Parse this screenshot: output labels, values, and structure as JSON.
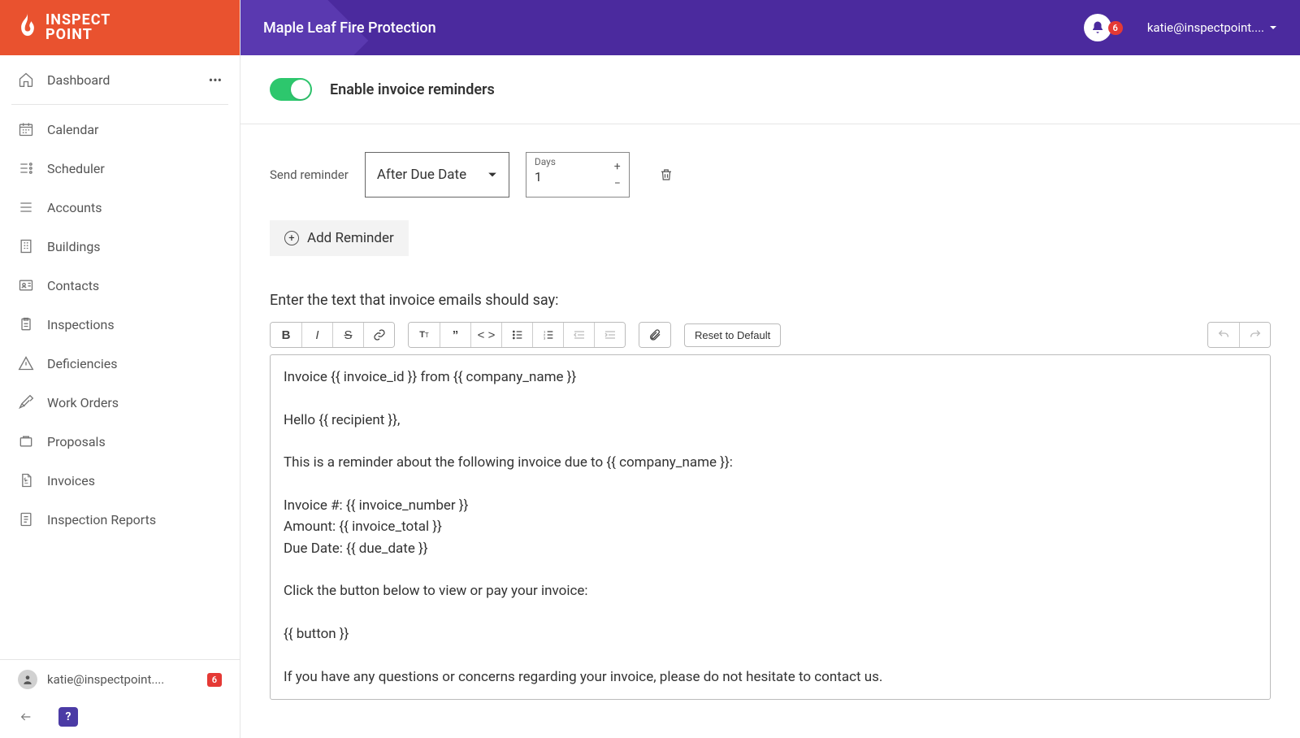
{
  "brand": {
    "line1": "INSPECT",
    "line2": "POINT"
  },
  "header": {
    "title": "Maple Leaf Fire Protection",
    "notif_count": "6",
    "user_email": "katie@inspectpoint...."
  },
  "sidebar": {
    "dashboard": "Dashboard",
    "items": [
      {
        "label": "Calendar",
        "icon": "calendar-icon"
      },
      {
        "label": "Scheduler",
        "icon": "scheduler-icon"
      },
      {
        "label": "Accounts",
        "icon": "accounts-icon"
      },
      {
        "label": "Buildings",
        "icon": "buildings-icon"
      },
      {
        "label": "Contacts",
        "icon": "contacts-icon"
      },
      {
        "label": "Inspections",
        "icon": "inspections-icon"
      },
      {
        "label": "Deficiencies",
        "icon": "deficiencies-icon"
      },
      {
        "label": "Work Orders",
        "icon": "work-orders-icon"
      },
      {
        "label": "Proposals",
        "icon": "proposals-icon"
      },
      {
        "label": "Invoices",
        "icon": "invoices-icon"
      },
      {
        "label": "Inspection Reports",
        "icon": "reports-icon"
      }
    ],
    "footer_email": "katie@inspectpoint....",
    "footer_badge": "6"
  },
  "settings": {
    "toggle_label": "Enable invoice reminders",
    "toggle_on": true,
    "send_label": "Send reminder",
    "timing_value": "After Due Date",
    "days_label": "Days",
    "days_value": "1",
    "add_reminder": "Add Reminder",
    "editor_label": "Enter the text that invoice emails should say:",
    "reset_label": "Reset to Default",
    "editor_body": "Invoice {{ invoice_id }} from {{ company_name }}\n\nHello {{ recipient }},\n\nThis is a reminder about the following invoice due to {{ company_name }}:\n\nInvoice #: {{ invoice_number }}\nAmount: {{ invoice_total }}\nDue Date: {{ due_date }}\n\nClick the button below to view or pay your invoice:\n\n{{ button }}\n\nIf you have any questions or concerns regarding your invoice, please do not hesitate to contact us."
  }
}
